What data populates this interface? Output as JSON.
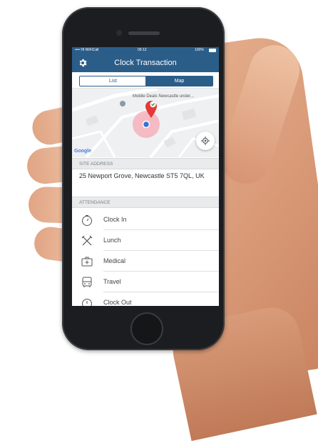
{
  "status_bar": {
    "carrier": "•••• HI WiFiCall",
    "time": "09:12",
    "battery": "100%"
  },
  "nav": {
    "title": "Clock Transaction",
    "settings_icon": "gear-icon"
  },
  "tabs": [
    {
      "label": "List",
      "selected": false
    },
    {
      "label": "Map",
      "selected": true
    }
  ],
  "map": {
    "place_label": "Mobile Deals Newcastle under...",
    "attribution": "Google",
    "locate_icon": "crosshair-icon",
    "marker_icon": "map-pin-check-icon"
  },
  "site_address": {
    "header": "SITE ADDRESS",
    "value": "25 Newport Grove, Newcastle ST5 7QL, UK"
  },
  "attendance": {
    "header": "ATTENDANCE",
    "items": [
      {
        "label": "Clock In",
        "icon": "stopwatch-icon"
      },
      {
        "label": "Lunch",
        "icon": "fork-knife-icon"
      },
      {
        "label": "Medical",
        "icon": "medical-kit-icon"
      },
      {
        "label": "Travel",
        "icon": "bus-icon"
      },
      {
        "label": "Clock Out",
        "icon": "stopwatch-icon"
      }
    ]
  },
  "colors": {
    "primary": "#2b5d89",
    "marker": "#e53935",
    "accuracy_circle": "#f5aab4"
  }
}
